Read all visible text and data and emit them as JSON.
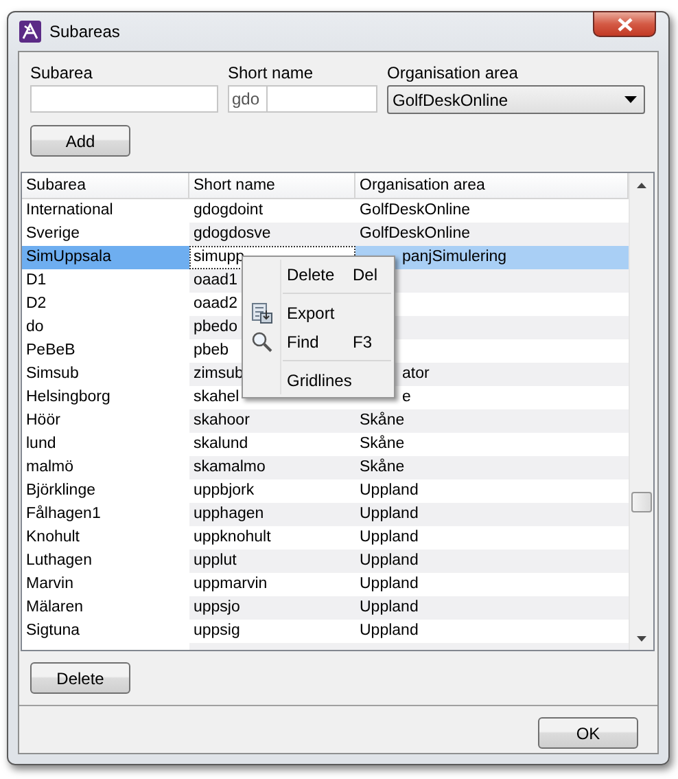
{
  "window": {
    "title": "Subareas"
  },
  "form": {
    "subarea": {
      "label": "Subarea"
    },
    "short_name": {
      "label": "Short name",
      "prefix": "gdo"
    },
    "organisation_area": {
      "label": "Organisation area",
      "value": "GolfDeskOnline"
    },
    "add_button": "Add"
  },
  "table": {
    "columns": [
      "Subarea",
      "Short name",
      "Organisation area"
    ],
    "rows": [
      {
        "cells": [
          {
            "text": "International"
          },
          {
            "text": "gdogdoint"
          },
          {
            "text": "GolfDeskOnline"
          }
        ],
        "selected": false
      },
      {
        "cells": [
          {
            "text": "Sverige"
          },
          {
            "text": "gdogdosve"
          },
          {
            "text": "GolfDeskOnline"
          }
        ],
        "selected": false
      },
      {
        "cells": [
          {
            "text": "SimUppsala"
          },
          {
            "text": "simupp"
          },
          {
            "text": "panjSimulering",
            "behind_menu": true
          }
        ],
        "selected": true
      },
      {
        "cells": [
          {
            "text": "D1"
          },
          {
            "text": "oaad1"
          }
        ],
        "selected": false
      },
      {
        "cells": [
          {
            "text": "D2"
          },
          {
            "text": "oaad2"
          }
        ],
        "selected": false
      },
      {
        "cells": [
          {
            "text": "do"
          },
          {
            "text": "pbedo"
          }
        ],
        "selected": false
      },
      {
        "cells": [
          {
            "text": "PeBeB"
          },
          {
            "text": "pbeb"
          }
        ],
        "selected": false
      },
      {
        "cells": [
          {
            "text": "Simsub"
          },
          {
            "text": "zimsub"
          },
          {
            "text": "ator",
            "behind_menu": true
          }
        ],
        "selected": false
      },
      {
        "cells": [
          {
            "text": "Helsingborg"
          },
          {
            "text": "skahel"
          },
          {
            "text": "e",
            "behind_menu": true
          }
        ],
        "selected": false
      },
      {
        "cells": [
          {
            "text": "Höör"
          },
          {
            "text": "skahoor"
          },
          {
            "text": "Skåne"
          }
        ],
        "selected": false
      },
      {
        "cells": [
          {
            "text": "lund"
          },
          {
            "text": "skalund"
          },
          {
            "text": "Skåne"
          }
        ],
        "selected": false
      },
      {
        "cells": [
          {
            "text": "malmö"
          },
          {
            "text": "skamalmo"
          },
          {
            "text": "Skåne"
          }
        ],
        "selected": false
      },
      {
        "cells": [
          {
            "text": "Björklinge"
          },
          {
            "text": "uppbjork"
          },
          {
            "text": "Uppland"
          }
        ],
        "selected": false
      },
      {
        "cells": [
          {
            "text": "Fålhagen1"
          },
          {
            "text": "upphagen"
          },
          {
            "text": "Uppland"
          }
        ],
        "selected": false
      },
      {
        "cells": [
          {
            "text": "Knohult"
          },
          {
            "text": "uppknohult"
          },
          {
            "text": "Uppland"
          }
        ],
        "selected": false
      },
      {
        "cells": [
          {
            "text": "Luthagen"
          },
          {
            "text": "upplut"
          },
          {
            "text": "Uppland"
          }
        ],
        "selected": false
      },
      {
        "cells": [
          {
            "text": "Marvin"
          },
          {
            "text": "uppmarvin"
          },
          {
            "text": "Uppland"
          }
        ],
        "selected": false
      },
      {
        "cells": [
          {
            "text": "Mälaren"
          },
          {
            "text": "uppsjo"
          },
          {
            "text": "Uppland"
          }
        ],
        "selected": false
      },
      {
        "cells": [
          {
            "text": "Sigtuna"
          },
          {
            "text": "uppsig"
          },
          {
            "text": "Uppland"
          }
        ],
        "selected": false
      }
    ]
  },
  "context_menu": {
    "items": [
      {
        "kind": "plain",
        "label": "Delete",
        "shortcut": "Del"
      },
      {
        "kind": "separator"
      },
      {
        "kind": "export",
        "label": "Export"
      },
      {
        "kind": "search",
        "label": "Find",
        "shortcut": "F3"
      },
      {
        "kind": "separator"
      },
      {
        "kind": "plain",
        "label": "Gridlines"
      }
    ]
  },
  "delete_button": "Delete",
  "ok_button": "OK"
}
